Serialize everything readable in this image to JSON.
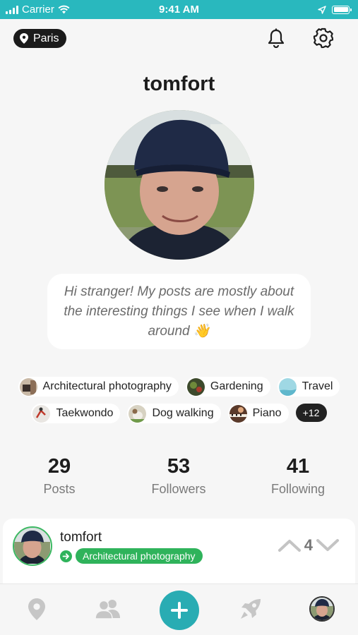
{
  "status_bar": {
    "carrier": "Carrier",
    "time": "9:41 AM"
  },
  "header": {
    "location": "Paris",
    "username": "tomfort"
  },
  "icons": {
    "location": "location-pin-icon",
    "notifications": "bell-icon",
    "settings": "gear-icon",
    "tab_map": "location-pin-icon",
    "tab_people": "people-icon",
    "tab_add": "plus-icon",
    "tab_explore": "rocket-icon",
    "tab_profile": "avatar"
  },
  "bio": {
    "text": "Hi stranger! My posts are mostly about the interesting things I see when I walk around 👋"
  },
  "interests": {
    "row1": [
      {
        "label": "Architectural photography"
      },
      {
        "label": "Gardening"
      },
      {
        "label": "Travel"
      }
    ],
    "row2": [
      {
        "label": "Taekwondo"
      },
      {
        "label": "Dog walking"
      },
      {
        "label": "Piano"
      }
    ],
    "more": "+12"
  },
  "stats": {
    "posts": {
      "value": "29",
      "label": "Posts"
    },
    "followers": {
      "value": "53",
      "label": "Followers"
    },
    "following": {
      "value": "41",
      "label": "Following"
    }
  },
  "post": {
    "username": "tomfort",
    "tag": "Architectural photography",
    "votes": "4"
  },
  "colors": {
    "accent": "#29b8be",
    "tag_green": "#2fb35b",
    "dark": "#1b1b1b"
  }
}
